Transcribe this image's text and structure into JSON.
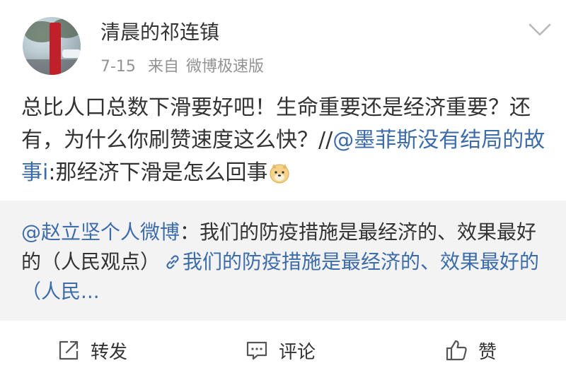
{
  "user": {
    "name": "清晨的祁连镇",
    "date": "7-15",
    "source_prefix": "来自",
    "source": "微博极速版"
  },
  "post": {
    "text_main": "总比人口总数下滑要好吧！生命重要还是经济重要？还有，为什么你刷赞速度这么快？//",
    "mention": "@墨菲斯没有结局的故事i",
    "text_after_mention": ":那经济下滑是怎么回事",
    "emoji": "doge-emoji"
  },
  "quoted": {
    "author": "@赵立坚个人微博",
    "text": "：我们的防疫措施是最经济的、效果最好的（人民观点）",
    "link_text": "我们的防疫措施是最经济的、效果最好的（人民..."
  },
  "actions": {
    "repost_label": "转发",
    "comment_label": "评论",
    "like_label": "赞"
  },
  "colors": {
    "link": "#3d6cab",
    "text": "#333333",
    "meta": "#939393",
    "quote_bg": "#f3f3f3"
  }
}
